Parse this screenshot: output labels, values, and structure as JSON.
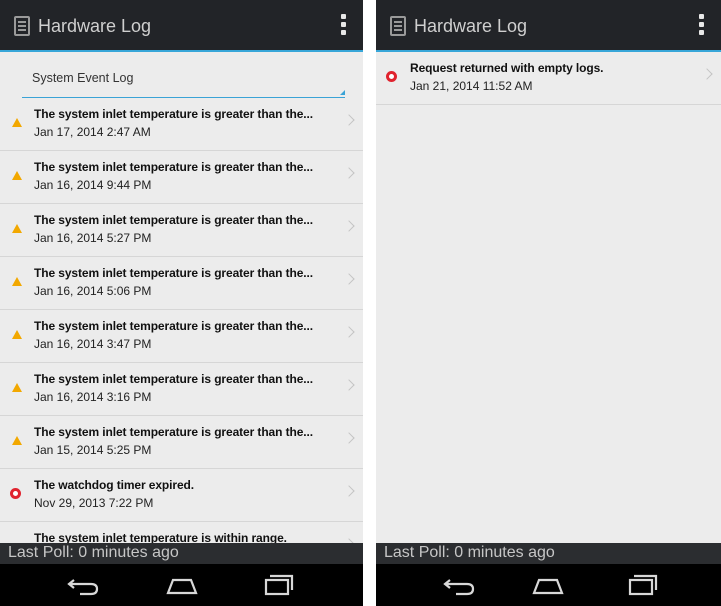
{
  "left": {
    "title": "Hardware Log",
    "spinner": "System Event Log",
    "items": [
      {
        "title": "The system inlet temperature is greater than the...",
        "date": "Jan 17, 2014 2:47 AM",
        "severity": "warning"
      },
      {
        "title": "The system inlet temperature is greater than the...",
        "date": "Jan 16, 2014 9:44 PM",
        "severity": "warning"
      },
      {
        "title": "The system inlet temperature is greater than the...",
        "date": "Jan 16, 2014 5:27 PM",
        "severity": "warning"
      },
      {
        "title": "The system inlet temperature is greater than the...",
        "date": "Jan 16, 2014 5:06 PM",
        "severity": "warning"
      },
      {
        "title": "The system inlet temperature is greater than the...",
        "date": "Jan 16, 2014 3:47 PM",
        "severity": "warning"
      },
      {
        "title": "The system inlet temperature is greater than the...",
        "date": "Jan 16, 2014 3:16 PM",
        "severity": "warning"
      },
      {
        "title": "The system inlet temperature is greater than the...",
        "date": "Jan 15, 2014 5:25 PM",
        "severity": "warning"
      },
      {
        "title": "The watchdog timer expired.",
        "date": "Nov 29, 2013 7:22 PM",
        "severity": "error"
      },
      {
        "title": "The system inlet temperature is within range.",
        "date": "",
        "severity": "ok"
      }
    ],
    "poll": "Last Poll: 0 minutes ago"
  },
  "right": {
    "title": "Hardware Log",
    "items": [
      {
        "title": "Request returned with empty logs.",
        "date": "Jan 21, 2014 11:52 AM",
        "severity": "error"
      }
    ],
    "poll": "Last Poll: 0 minutes ago"
  },
  "colors": {
    "accent": "#37a6d8",
    "warning": "#f2a800",
    "error": "#e0232e"
  },
  "icons": {
    "app": "document-list-icon",
    "overflow": "overflow-menu-icon",
    "back": "back-icon",
    "home": "home-icon",
    "recents": "recents-icon"
  }
}
